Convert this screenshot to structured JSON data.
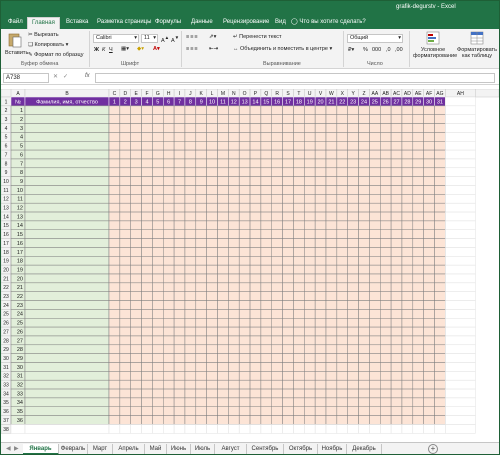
{
  "window": {
    "title": "grafik-degurstv - Excel"
  },
  "ribbon_tabs": [
    {
      "label": "Файл",
      "active": false
    },
    {
      "label": "Главная",
      "active": true
    },
    {
      "label": "Вставка",
      "active": false
    },
    {
      "label": "Разметка страницы",
      "active": false
    },
    {
      "label": "Формулы",
      "active": false
    },
    {
      "label": "Данные",
      "active": false
    },
    {
      "label": "Рецензирование",
      "active": false
    },
    {
      "label": "Вид",
      "active": false
    }
  ],
  "tell_me": "Что вы хотите сделать?",
  "ribbon": {
    "paste_label": "Вставить",
    "cut_label": "Вырезать",
    "copy_label": "Копировать",
    "format_painter_label": "Формат по образцу",
    "clipboard_group": "Буфер обмена",
    "font_name": "Calibri",
    "font_size": "11",
    "font_group": "Шрифт",
    "bold": "Ж",
    "italic": "К",
    "underline": "Ч",
    "wrap_text": "Перенести текст",
    "merge_center": "Объединить и поместить в центре",
    "alignment_group": "Выравнивание",
    "number_format": "Общий",
    "number_group": "Число",
    "conditional_formatting": "Условное форматирование",
    "format_as_table": "Форматировать как таблицу"
  },
  "formula_bar": {
    "name_box": "A738",
    "fx": "fx",
    "value": ""
  },
  "grid": {
    "columns": [
      "A",
      "B",
      "C",
      "D",
      "E",
      "F",
      "G",
      "H",
      "I",
      "J",
      "K",
      "L",
      "M",
      "N",
      "O",
      "P",
      "Q",
      "R",
      "S",
      "T",
      "U",
      "V",
      "W",
      "X",
      "Y",
      "Z",
      "AA",
      "AB",
      "AC",
      "AD",
      "AE",
      "AF",
      "AG",
      "AH"
    ],
    "header_row": {
      "num": "№",
      "name": "Фамилия, имя, отчество",
      "days": [
        "1",
        "2",
        "3",
        "4",
        "5",
        "6",
        "7",
        "8",
        "9",
        "10",
        "11",
        "12",
        "13",
        "14",
        "15",
        "16",
        "17",
        "18",
        "19",
        "20",
        "21",
        "22",
        "23",
        "24",
        "25",
        "26",
        "27",
        "28",
        "29",
        "30",
        "31"
      ]
    },
    "row_numbers": [
      "1",
      "2",
      "3",
      "4",
      "5",
      "6",
      "7",
      "8",
      "9",
      "10",
      "11",
      "12",
      "13",
      "14",
      "15",
      "16",
      "17",
      "18",
      "19",
      "20",
      "21",
      "22",
      "23",
      "24",
      "25",
      "26",
      "27",
      "28",
      "29",
      "30",
      "31",
      "32",
      "33",
      "34",
      "35",
      "36",
      "37",
      "38"
    ],
    "item_numbers": [
      "1",
      "2",
      "3",
      "4",
      "5",
      "6",
      "7",
      "8",
      "9",
      "10",
      "11",
      "12",
      "13",
      "14",
      "15",
      "16",
      "17",
      "18",
      "19",
      "20",
      "21",
      "22",
      "23",
      "24",
      "25",
      "26",
      "27",
      "28",
      "29",
      "30",
      "31",
      "32",
      "33",
      "34",
      "35",
      "36"
    ],
    "colors": {
      "header_bg": "#7030a0",
      "name_col_bg": "#e2efda",
      "day_bg": "#fce4d6"
    }
  },
  "sheet_tabs": [
    "Январь",
    "Февраль",
    "Март",
    "Апрель",
    "Май",
    "Июнь",
    "Июль",
    "Август",
    "Сентябрь",
    "Октябрь",
    "Ноябрь",
    "Декабрь"
  ],
  "active_sheet": "Январь"
}
